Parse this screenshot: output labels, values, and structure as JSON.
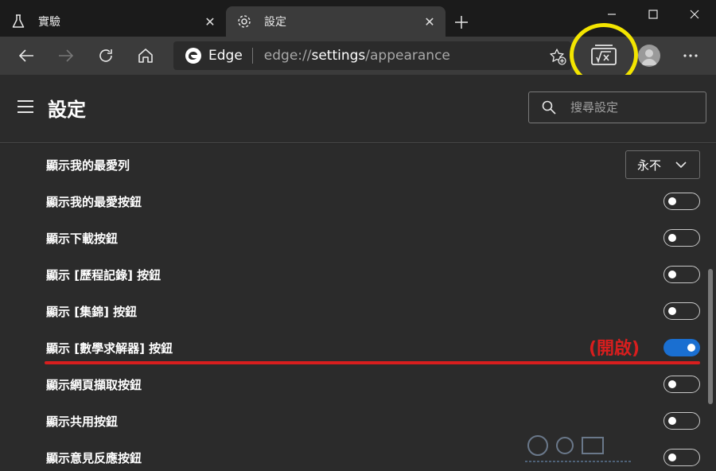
{
  "tabs": [
    {
      "label": "實驗",
      "icon": "flask-icon",
      "active": false
    },
    {
      "label": "設定",
      "icon": "gear-icon",
      "active": true
    }
  ],
  "window_controls": {
    "minimize": "minimize-icon",
    "maximize": "maximize-icon",
    "close": "close-icon"
  },
  "toolbar": {
    "brand": "Edge",
    "url_prefix": "edge://",
    "url_highlight": "settings",
    "url_suffix": "/appearance"
  },
  "settings": {
    "title": "設定",
    "search_placeholder": "搜尋設定"
  },
  "rows": [
    {
      "label": "顯示我的最愛列",
      "control": "select",
      "value": "永不"
    },
    {
      "label": "顯示我的最愛按鈕",
      "control": "toggle",
      "on": false
    },
    {
      "label": "顯示下載按鈕",
      "control": "toggle",
      "on": false
    },
    {
      "label": "顯示 [歷程記錄] 按鈕",
      "control": "toggle",
      "on": false
    },
    {
      "label": "顯示 [集錦] 按鈕",
      "control": "toggle",
      "on": false
    },
    {
      "label": "顯示 [數學求解器] 按鈕",
      "control": "toggle",
      "on": true
    },
    {
      "label": "顯示網頁擷取按鈕",
      "control": "toggle",
      "on": false
    },
    {
      "label": "顯示共用按鈕",
      "control": "toggle",
      "on": false
    },
    {
      "label": "顯示意見反應按鈕",
      "control": "toggle",
      "on": false
    }
  ],
  "annotation": "(開啟)",
  "colors": {
    "accent": "#1a6fd1",
    "highlight_ring": "#f3e500",
    "annotation": "#d81e1e"
  }
}
